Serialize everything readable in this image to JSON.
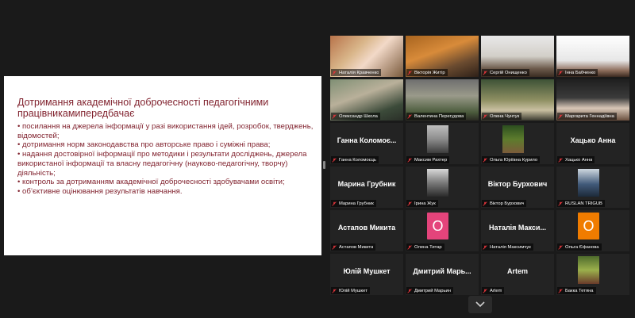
{
  "share": {
    "title": "Дотримання академічної доброчесності педагогічними працівникамипередбачає",
    "bullets": [
      "• посилання на джерела інформації у разі використання ідей, розробок, тверджень, відомостей;",
      "• дотримання норм законодавства про авторське право і суміжні права;",
      "• надання достовірної інформації про методики і результати досліджень, джерела використаної інформації та власну педагогічну (науково-педагогічну, творчу) діяльність;",
      "• контроль за дотриманням академічної доброчесності здобувачами освіти;",
      "• об’єктивне оцінювання результатів навчання."
    ]
  },
  "participants": [
    {
      "label": "Наталія Кравченко",
      "type": "video",
      "active": true
    },
    {
      "label": "Вікторія Житір",
      "type": "video"
    },
    {
      "label": "Сергій Онищенко",
      "type": "video"
    },
    {
      "label": "Інна Бабченко",
      "type": "video"
    },
    {
      "label": "Олександр Школа",
      "type": "video"
    },
    {
      "label": "Валентина Перегудова",
      "type": "video"
    },
    {
      "label": "Олена Чунтук",
      "type": "video"
    },
    {
      "label": "Маргарита Геннадіївна",
      "type": "video"
    },
    {
      "label": "Ганна Коломоєць",
      "type": "name",
      "display": "Ганна Коломоє..."
    },
    {
      "label": "Максим Рахтер",
      "type": "photo"
    },
    {
      "label": "Ольга Юріївна Курило",
      "type": "photo"
    },
    {
      "label": "Хацько Анна",
      "type": "name",
      "display": "Хацько Анна"
    },
    {
      "label": "Марина Грубник",
      "type": "name",
      "display": "Марина Грубник"
    },
    {
      "label": "Ірина Жук",
      "type": "photo"
    },
    {
      "label": "Віктор Бурхович",
      "type": "name",
      "display": "Віктор Бурхович"
    },
    {
      "label": "RUSLAN TRIGUB",
      "type": "photo"
    },
    {
      "label": "Астапов Микита",
      "type": "name",
      "display": "Астапов Микита"
    },
    {
      "label": "Олена Титар",
      "type": "avatar",
      "initial": "О",
      "color": "#e4447b"
    },
    {
      "label": "Наталія Максимчук",
      "type": "name",
      "display": "Наталія Макси..."
    },
    {
      "label": "Ольга Єфанова",
      "type": "avatar",
      "initial": "О",
      "color": "#f07c00"
    },
    {
      "label": "Юлій Мушкет",
      "type": "name",
      "display": "Юлій Мушкет"
    },
    {
      "label": "Дмитрий Марьин",
      "type": "name",
      "display": "Дмитрий Марь..."
    },
    {
      "label": "Artem",
      "type": "name",
      "display": "Artem"
    },
    {
      "label": "Бакка Тетяна",
      "type": "photo"
    }
  ],
  "colors": {
    "muted_mic": "#e0353b",
    "active_speaker": "#c8cf3a",
    "slide_text": "#7f1f2b"
  },
  "icons": {
    "mic": "muted-mic-icon",
    "chevron": "chevron-down-icon"
  }
}
